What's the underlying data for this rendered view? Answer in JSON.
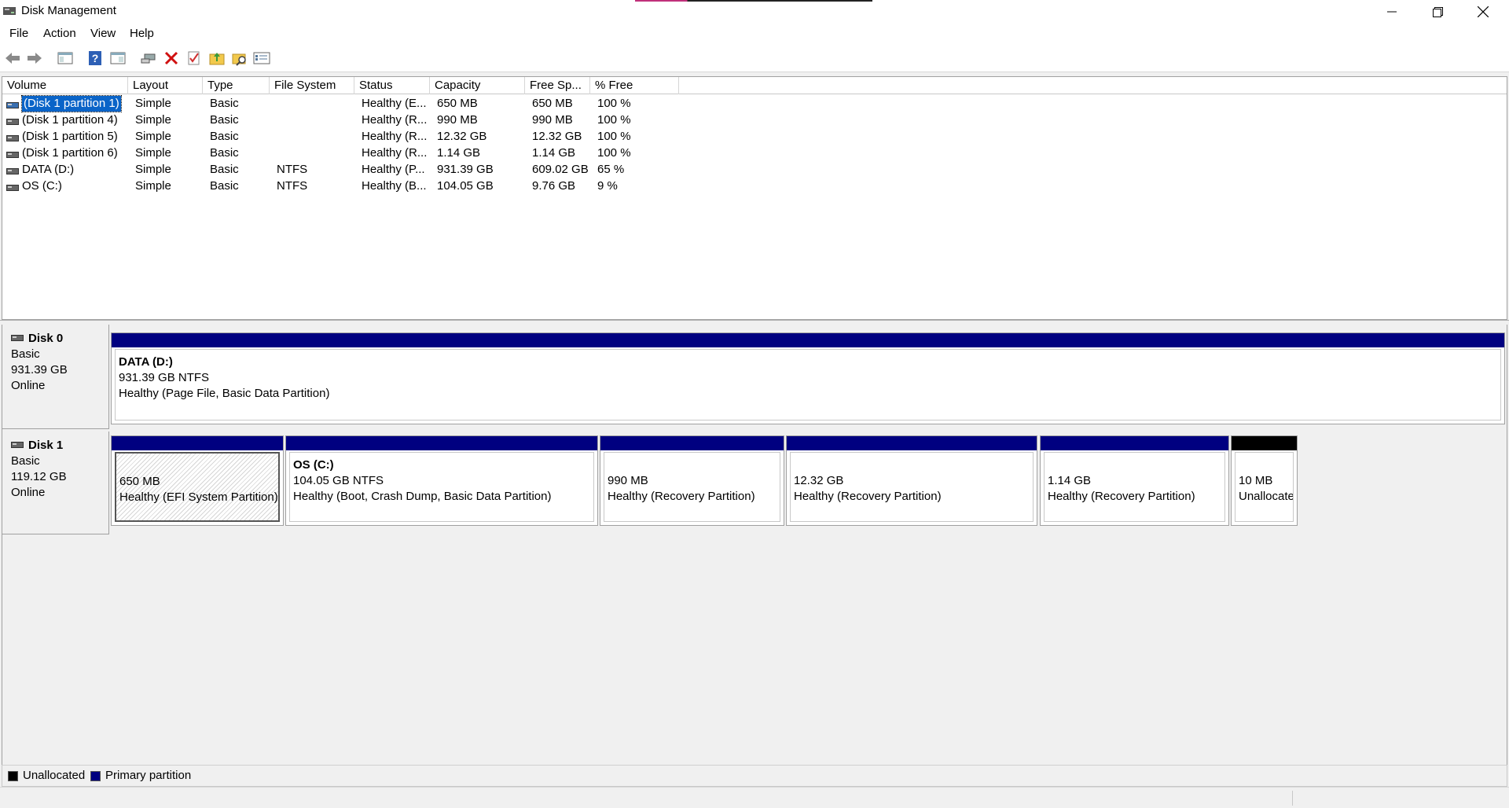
{
  "window": {
    "title": "Disk Management"
  },
  "menu": [
    "File",
    "Action",
    "View",
    "Help"
  ],
  "toolbar": [
    "back-icon",
    "forward-icon",
    "console-tree-icon",
    "help-icon",
    "properties-icon",
    "connect-icon",
    "delete-icon",
    "check-icon",
    "folder-up-icon",
    "folder-search-icon",
    "settings-list-icon"
  ],
  "volumes": {
    "columns": [
      "Volume",
      "Layout",
      "Type",
      "File System",
      "Status",
      "Capacity",
      "Free Sp...",
      "% Free"
    ],
    "rows": [
      [
        "(Disk 1 partition 1)",
        "Simple",
        "Basic",
        "",
        "Healthy (E...",
        "650 MB",
        "650 MB",
        "100 %"
      ],
      [
        "(Disk 1 partition 4)",
        "Simple",
        "Basic",
        "",
        "Healthy (R...",
        "990 MB",
        "990 MB",
        "100 %"
      ],
      [
        "(Disk 1 partition 5)",
        "Simple",
        "Basic",
        "",
        "Healthy (R...",
        "12.32 GB",
        "12.32 GB",
        "100 %"
      ],
      [
        "(Disk 1 partition 6)",
        "Simple",
        "Basic",
        "",
        "Healthy (R...",
        "1.14 GB",
        "1.14 GB",
        "100 %"
      ],
      [
        "DATA (D:)",
        "Simple",
        "Basic",
        "NTFS",
        "Healthy (P...",
        "931.39 GB",
        "609.02 GB",
        "65 %"
      ],
      [
        "OS (C:)",
        "Simple",
        "Basic",
        "NTFS",
        "Healthy (B...",
        "104.05 GB",
        "9.76 GB",
        "9 %"
      ]
    ]
  },
  "disks": [
    {
      "name": "Disk 0",
      "type": "Basic",
      "size": "931.39 GB",
      "status": "Online",
      "partitions": [
        {
          "name": "DATA  (D:)",
          "size": "931.39 GB NTFS",
          "status": "Healthy (Page File, Basic Data Partition)"
        }
      ]
    },
    {
      "name": "Disk 1",
      "type": "Basic",
      "size": "119.12 GB",
      "status": "Online",
      "partitions": [
        {
          "name": "",
          "size": "650 MB",
          "status": "Healthy (EFI System Partition)"
        },
        {
          "name": "OS  (C:)",
          "size": "104.05 GB NTFS",
          "status": "Healthy (Boot, Crash Dump, Basic Data Partition)"
        },
        {
          "name": "",
          "size": "990 MB",
          "status": "Healthy (Recovery Partition)"
        },
        {
          "name": "",
          "size": "12.32 GB",
          "status": "Healthy (Recovery Partition)"
        },
        {
          "name": "",
          "size": "1.14 GB",
          "status": "Healthy (Recovery Partition)"
        },
        {
          "name": "",
          "size": "10 MB",
          "status": "Unallocated"
        }
      ]
    }
  ],
  "legend": [
    {
      "label": "Unallocated",
      "color": "#000000"
    },
    {
      "label": "Primary partition",
      "color": "#000080"
    }
  ]
}
